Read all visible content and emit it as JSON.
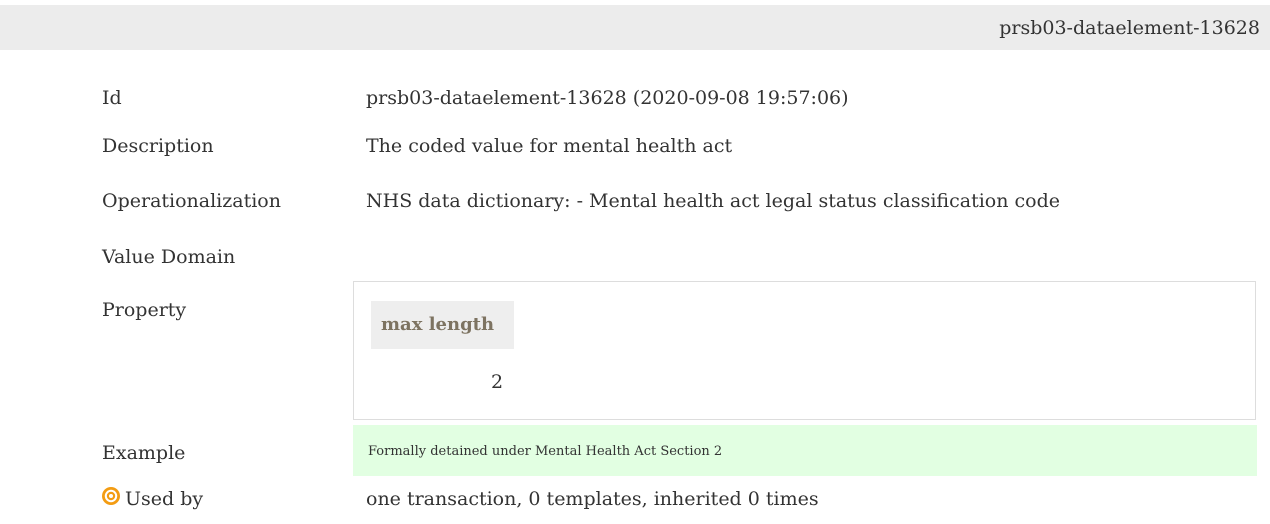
{
  "header": {
    "title": "prsb03-dataelement-13628"
  },
  "fields": {
    "id_label": "Id",
    "id_value": "prsb03-dataelement-13628 (2020-09-08 19:57:06)",
    "description_label": "Description",
    "description_value": "The coded value for mental health act",
    "operationalization_label": "Operationalization",
    "operationalization_value": "NHS data dictionary: - Mental health act legal status classification code",
    "value_domain_label": "Value Domain",
    "property_label": "Property",
    "example_label": "Example",
    "used_by_label": "Used by",
    "used_by_value": "one transaction, 0 templates, inherited 0 times"
  },
  "property": {
    "header": "max length",
    "value": "2"
  },
  "example": {
    "text": "Formally detained under Mental Health Act Section 2",
    "background": "#e2ffe2"
  },
  "icons": {
    "used_by_icon": "target-icon"
  },
  "colors": {
    "header_bar": "#ececec",
    "icon_accent": "#f39c12",
    "property_header_text": "#7d7361"
  }
}
